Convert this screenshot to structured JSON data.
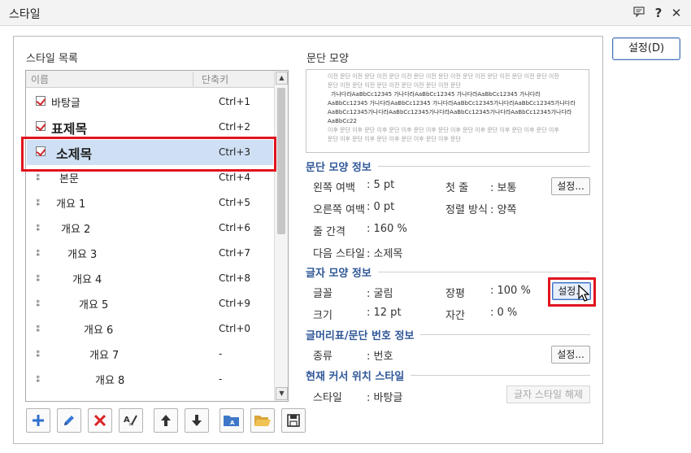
{
  "window": {
    "title": "스타일",
    "right_button": "설정(D)"
  },
  "style_list": {
    "label": "스타일 목록",
    "col_name": "이름",
    "col_key": "단축키",
    "items": [
      {
        "name": "바탕글",
        "key": "Ctrl+1",
        "type": "char"
      },
      {
        "name": "표제목",
        "key": "Ctrl+2",
        "type": "char"
      },
      {
        "name": "소제목",
        "key": "Ctrl+3",
        "type": "char",
        "selected": true
      },
      {
        "name": "본문",
        "key": "Ctrl+4",
        "type": "para"
      },
      {
        "name": "개요 1",
        "key": "Ctrl+5",
        "type": "para"
      },
      {
        "name": "개요 2",
        "key": "Ctrl+6",
        "type": "para"
      },
      {
        "name": "개요 3",
        "key": "Ctrl+7",
        "type": "para"
      },
      {
        "name": "개요 4",
        "key": "Ctrl+8",
        "type": "para"
      },
      {
        "name": "개요 5",
        "key": "Ctrl+9",
        "type": "para"
      },
      {
        "name": "개요 6",
        "key": "Ctrl+0",
        "type": "para"
      },
      {
        "name": "개요 7",
        "key": "-",
        "type": "para"
      },
      {
        "name": "개요 8",
        "key": "-",
        "type": "para"
      }
    ]
  },
  "preview": {
    "label": "문단 모양",
    "lines": [
      {
        "text": "이전 문단 이전 문단 이전 문단 이전 문단 이전 문단 이전 문단 이전 문단 이전 문단 이전 문단 이전",
        "tone": "gray"
      },
      {
        "text": "문단 이전 문단 이전 문단 이전 문단 이전 문단 이전 문단",
        "tone": "gray"
      },
      {
        "text": "가나다라AaBbCc12345      가나다라AaBbCc12345      가나다라AaBbCc12345      가나다라",
        "tone": "cur"
      },
      {
        "text": "AaBbCc12345    가나다라AaBbCc12345    가나다라AaBbCc12345가나다라AaBbCc12345가나다라",
        "tone": "cur"
      },
      {
        "text": "AaBbCc12345가나다라AaBbCc12345가나다라AaBbCc12345가나다라AaBbCc12345가나다라",
        "tone": "cur"
      },
      {
        "text": "AaBbCc22",
        "tone": "cur"
      },
      {
        "text": "이후 문단 이후 문단 이후 문단 이후 문단 이후 문단 이후 문단 이후 문단 이후 문단 이후 문단 이후",
        "tone": "gray"
      },
      {
        "text": "문단 이후 문단 이후 문단 이후 문단 이후 문단 이후 문단",
        "tone": "gray"
      }
    ]
  },
  "para_info": {
    "title": "문단 모양 정보",
    "left_margin_label": "왼쪽 여백",
    "left_margin_value": ": 5 pt",
    "first_line_label": "첫 줄",
    "first_line_value": ": 보통",
    "right_margin_label": "오른쪽 여백",
    "right_margin_value": ": 0 pt",
    "align_label": "정렬 방식",
    "align_value": ": 양쪽",
    "line_spacing_label": "줄 간격",
    "line_spacing_value": ": 160 %",
    "next_style_label": "다음 스타일",
    "next_style_value": ": 소제목",
    "settings_button": "설정..."
  },
  "char_info": {
    "title": "글자 모양 정보",
    "font_label": "글꼴",
    "font_value": ": 굴림",
    "ratio_label": "장평",
    "ratio_value": ": 100 %",
    "size_label": "크기",
    "size_value": ": 12 pt",
    "spacing_label": "자간",
    "spacing_value": ": 0 %",
    "settings_button": "설정..."
  },
  "bullet_info": {
    "title": "글머리표/문단 번호 정보",
    "kind_label": "종류",
    "kind_value": ": 번호",
    "settings_button": "설정..."
  },
  "cursor_style": {
    "title": "현재 커서 위치 스타일",
    "style_label": "스타일",
    "style_value": ": 바탕글",
    "release_button": "글자 스타일 해제"
  }
}
